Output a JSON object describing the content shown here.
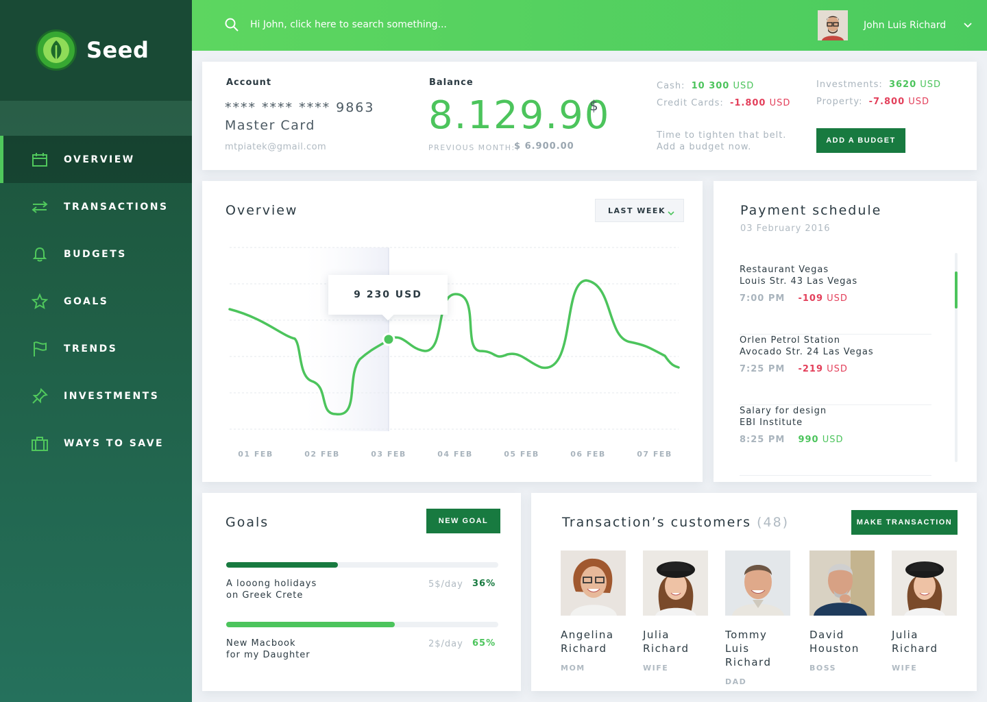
{
  "app": {
    "name": "Seed"
  },
  "colors": {
    "accent": "#4cc45c",
    "dark_green": "#187a40",
    "negative": "#e3405b",
    "sidebar": "#1f5d44"
  },
  "sidebar": {
    "items": [
      {
        "label": "OVERVIEW",
        "icon": "calendar-icon",
        "active": true
      },
      {
        "label": "TRANSACTIONS",
        "icon": "arrows-exchange-icon",
        "active": false
      },
      {
        "label": "BUDGETS",
        "icon": "bell-icon",
        "active": false
      },
      {
        "label": "GOALS",
        "icon": "star-icon",
        "active": false
      },
      {
        "label": "TRENDS",
        "icon": "flag-icon",
        "active": false
      },
      {
        "label": "INVESTMENTS",
        "icon": "pin-icon",
        "active": false
      },
      {
        "label": "WAYS TO SAVE",
        "icon": "briefcase-icon",
        "active": false
      }
    ]
  },
  "topbar": {
    "search_placeholder": "Hi John, click here to search something...",
    "user_name": "John Luis Richard"
  },
  "account": {
    "label": "Account",
    "number": "**** **** **** 9863",
    "type": "Master Card",
    "email": "mtpiatek@gmail.com"
  },
  "balance": {
    "label": "Balance",
    "value": "8.129.90",
    "currency": "$",
    "previous_label": "PREVIOUS MONTH:",
    "previous_value": "$ 6.900.00"
  },
  "stats": {
    "cash_label": "Cash:",
    "cash_value": "10 300",
    "cash_unit": "USD",
    "credit_label": "Credit Cards:",
    "credit_value": "-1.800",
    "credit_unit": "USD",
    "investments_label": "Investments:",
    "investments_value": "3620",
    "investments_unit": "USD",
    "property_label": "Property:",
    "property_value": "-7.800",
    "property_unit": "USD",
    "tip_line1": "Time to tighten that belt.",
    "tip_line2": "Add a budget now.",
    "add_budget_label": "ADD A BUDGET"
  },
  "overview": {
    "title": "Overview",
    "period": "LAST WEEK",
    "tooltip": "9 230 USD"
  },
  "chart_data": {
    "type": "line",
    "categories": [
      "01 FEB",
      "02 FEB",
      "03 FEB",
      "04 FEB",
      "05 FEB",
      "06 FEB",
      "07 FEB"
    ],
    "tooltip_category": "03 FEB",
    "tooltip_value": "9 230 USD",
    "grid": true
  },
  "payments": {
    "title": "Payment schedule",
    "date": "03 February 2016",
    "items": [
      {
        "line1": "Restaurant Vegas",
        "line2": "Louis Str. 43 Las Vegas",
        "time": "7:00 PM",
        "amount": "-109",
        "unit": "USD",
        "sign": "negative"
      },
      {
        "line1": "Orlen Petrol Station",
        "line2": "Avocado Str. 24 Las Vegas",
        "time": "7:25 PM",
        "amount": "-219",
        "unit": "USD",
        "sign": "negative"
      },
      {
        "line1": "Salary for design",
        "line2": "EBI Institute",
        "time": "8:25 PM",
        "amount": "990",
        "unit": "USD",
        "sign": "positive"
      }
    ]
  },
  "goals": {
    "title": "Goals",
    "new_goal_label": "NEW GOAL",
    "items": [
      {
        "line1": "A looong holidays",
        "line2": "on Greek Crete",
        "rate": "5$/day",
        "percent": "36%",
        "progress": 0.41,
        "color": "#187a40"
      },
      {
        "line1": "New Macbook",
        "line2": "for my Daughter",
        "rate": "2$/day",
        "percent": "65%",
        "progress": 0.62,
        "color": "#4cc45c"
      }
    ]
  },
  "customers": {
    "title": "Transaction’s customers",
    "count": "(48)",
    "make_transaction_label": "MAKE TRANSACTION",
    "items": [
      {
        "first": "Angelina",
        "last": "Richard",
        "role": "MOM"
      },
      {
        "first": "Julia",
        "last": "Richard",
        "role": "WIFE"
      },
      {
        "first": "Tommy Luis",
        "last": "Richard",
        "role": "DAD"
      },
      {
        "first": "David",
        "last": "Houston",
        "role": "BOSS"
      },
      {
        "first": "Julia",
        "last": "Richard",
        "role": "WIFE"
      }
    ]
  }
}
